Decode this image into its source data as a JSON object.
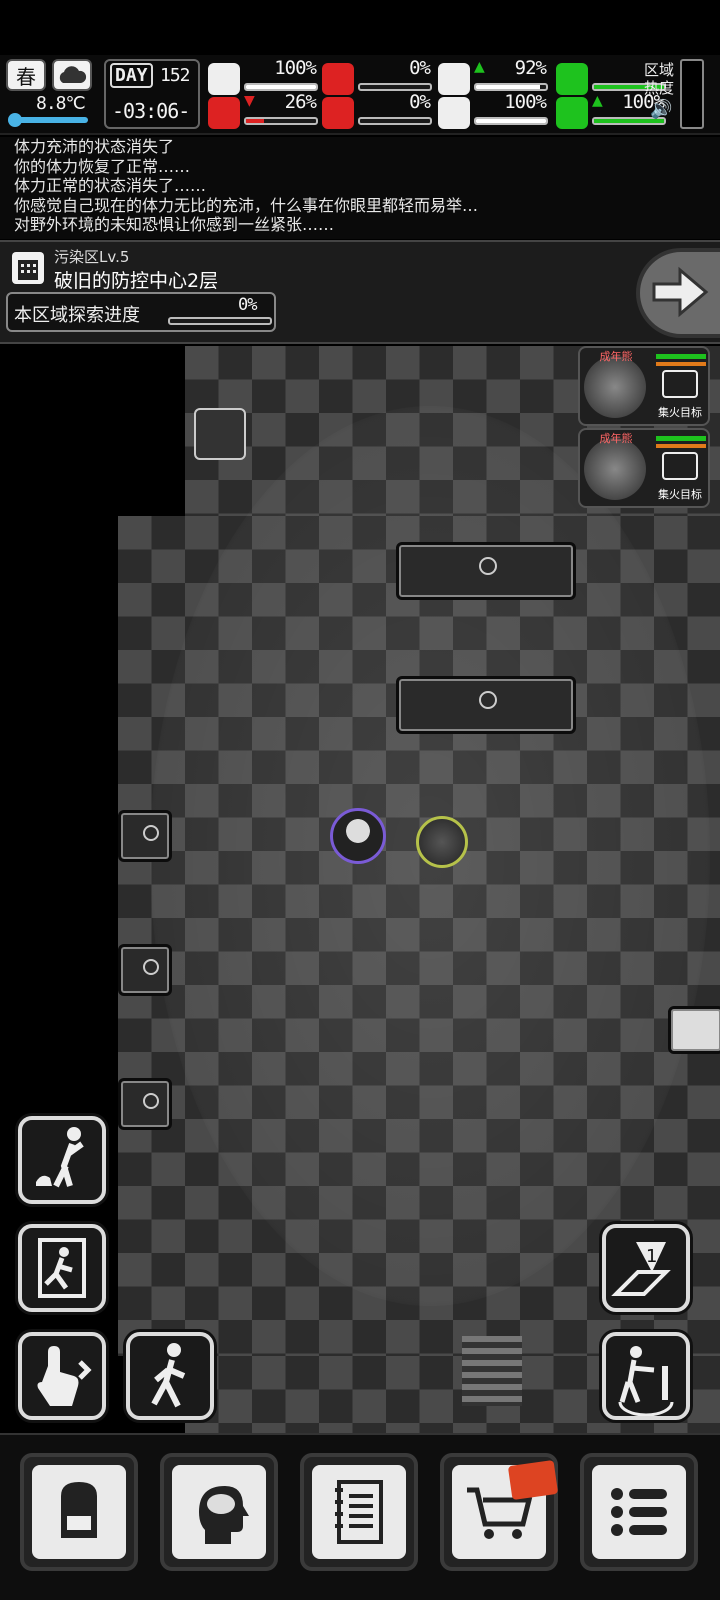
{
  "status": {
    "season": "春",
    "weather_icon": "cloud-icon",
    "temperature": "8.8℃",
    "day_label": "DAY",
    "day": "152",
    "time": "-03:06-",
    "region_heat_label": "区域\n热度",
    "stats": [
      {
        "name": "health",
        "icon": "medkit-icon",
        "pct": "100%",
        "level": 1.0,
        "color": "#ffffff"
      },
      {
        "name": "hunger",
        "icon": "stomach-icon",
        "pct": "0%",
        "level": 0.0,
        "color": "#d22"
      },
      {
        "name": "water",
        "icon": "bottle-icon",
        "pct": "92%",
        "level": 0.92,
        "color": "#ffffff",
        "trend": "up"
      },
      {
        "name": "stamina",
        "icon": "boot-icon",
        "pct": "",
        "level": 1.0,
        "color": "#1ec21e"
      },
      {
        "name": "infection",
        "icon": "virus-icon",
        "pct": "26%",
        "level": 0.26,
        "color": "#d22",
        "trend": "down"
      },
      {
        "name": "bleeding",
        "icon": "blood-drop-icon",
        "pct": "0%",
        "level": 0.0,
        "color": "#d22"
      },
      {
        "name": "mood",
        "icon": "heart-icon",
        "pct": "100%",
        "level": 1.0,
        "color": "#ffffff"
      },
      {
        "name": "energy",
        "icon": "energy-icon",
        "pct": "100%",
        "level": 1.0,
        "color": "#1ec21e",
        "trend": "up"
      }
    ]
  },
  "log": [
    "体力充沛的状态消失了",
    "你的体力恢复了正常……",
    "体力正常的状态消失了……",
    "你感觉自己现在的体力无比的充沛，什么事在你眼里都轻而易举…",
    "对野外环境的未知恐惧让你感到一丝紧张……"
  ],
  "area": {
    "zone": "污染区Lv.5",
    "name": "破旧的防控中心2层",
    "explore_label": "本区域探索进度",
    "explore_pct": "0%",
    "explore_level": 0.0
  },
  "enemies": [
    {
      "label": "成年熊",
      "focus_label": "集火目标"
    },
    {
      "label": "成年熊",
      "focus_label": "集火目标"
    }
  ],
  "colors": {
    "hp_green": "#1ec21e",
    "threat_orange": "#e07a1a",
    "danger_red": "#d22"
  }
}
